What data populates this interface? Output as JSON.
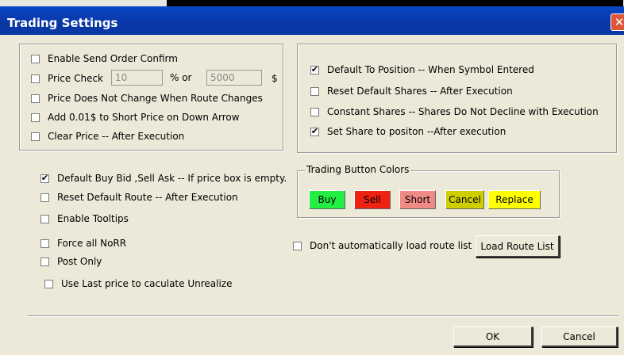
{
  "window": {
    "title": "Trading Settings",
    "close_glyph": "✕"
  },
  "left_group": {
    "enable_send_order_confirm": {
      "label": "Enable Send Order Confirm",
      "checked": false
    },
    "price_check": {
      "label": "Price Check",
      "checked": false,
      "value": "10",
      "percent_or": "% or",
      "dollar_value": "5000",
      "dollar_sign": "$"
    },
    "price_no_change": {
      "label": "Price Does Not Change When Route Changes",
      "checked": false
    },
    "add_001": {
      "label": "Add 0.01$ to Short Price on Down Arrow",
      "checked": false
    },
    "clear_price": {
      "label": "Clear Price -- After Execution",
      "checked": false
    }
  },
  "right_group": {
    "default_to_position": {
      "label": "Default To Position -- When Symbol Entered",
      "checked": true
    },
    "reset_default_shares": {
      "label": "Reset Default Shares -- After Execution",
      "checked": false
    },
    "constant_shares": {
      "label": "Constant Shares -- Shares Do Not Decline with Execution",
      "checked": false
    },
    "set_share_to_position": {
      "label": "Set Share to positon --After execution",
      "checked": true
    }
  },
  "options": {
    "default_buy_bid": {
      "label": "Default Buy Bid ,Sell Ask -- If price box is empty.",
      "checked": true
    },
    "reset_default_route": {
      "label": "Reset Default Route -- After Execution",
      "checked": false
    },
    "enable_tooltips": {
      "label": "Enable Tooltips",
      "checked": false
    },
    "force_all_norr": {
      "label": "Force all NoRR",
      "checked": false
    },
    "post_only": {
      "label": "Post Only",
      "checked": false
    },
    "use_last_price": {
      "label": "Use Last price to caculate Unrealize",
      "checked": false
    }
  },
  "trading_button_colors": {
    "legend": "Trading Button Colors",
    "buttons": [
      {
        "label": "Buy",
        "color": "#22ee44"
      },
      {
        "label": "Sell",
        "color": "#ee2211"
      },
      {
        "label": "Short",
        "color": "#f08a84"
      },
      {
        "label": "Cancel",
        "color": "#cfcf00"
      },
      {
        "label": "Replace",
        "color": "#ffff00"
      }
    ]
  },
  "route": {
    "dont_auto_load": {
      "label": "Don't automatically load route list",
      "checked": false
    },
    "load_button": "Load Route List"
  },
  "footer": {
    "ok": "OK",
    "cancel": "Cancel"
  }
}
